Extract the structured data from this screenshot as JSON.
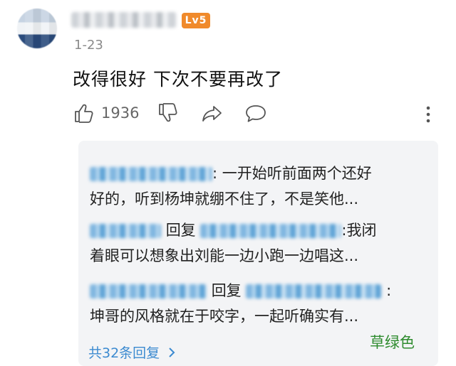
{
  "user": {
    "level_badge": "Lv5"
  },
  "comment": {
    "date": "1-23",
    "text": "改得很好 下次不要再改了",
    "like_count": "1936"
  },
  "replies": [
    {
      "text_line1": ": 一开始听前面两个还好",
      "text_line2": "好的，听到杨坤就绷不住了，不是笑他..."
    },
    {
      "reply_word": "回复",
      "text_line1": ":我闭",
      "text_line2": "着眼可以想象出刘能一边小跑一边唱这..."
    },
    {
      "reply_word": "回复",
      "text_line1": ":",
      "text_line2": "坤哥的风格就在于咬字，一起听确实有..."
    }
  ],
  "more_replies_label": "共32条回复",
  "watermark": "草绿色",
  "colors": {
    "badge": "#f08a2b",
    "link_blue": "#3b8ad0",
    "watermark_green": "#2e8b2e"
  },
  "icons": [
    "thumbs-up-icon",
    "thumbs-down-icon",
    "share-icon",
    "comment-icon",
    "more-vertical-icon",
    "chevron-right-icon"
  ]
}
